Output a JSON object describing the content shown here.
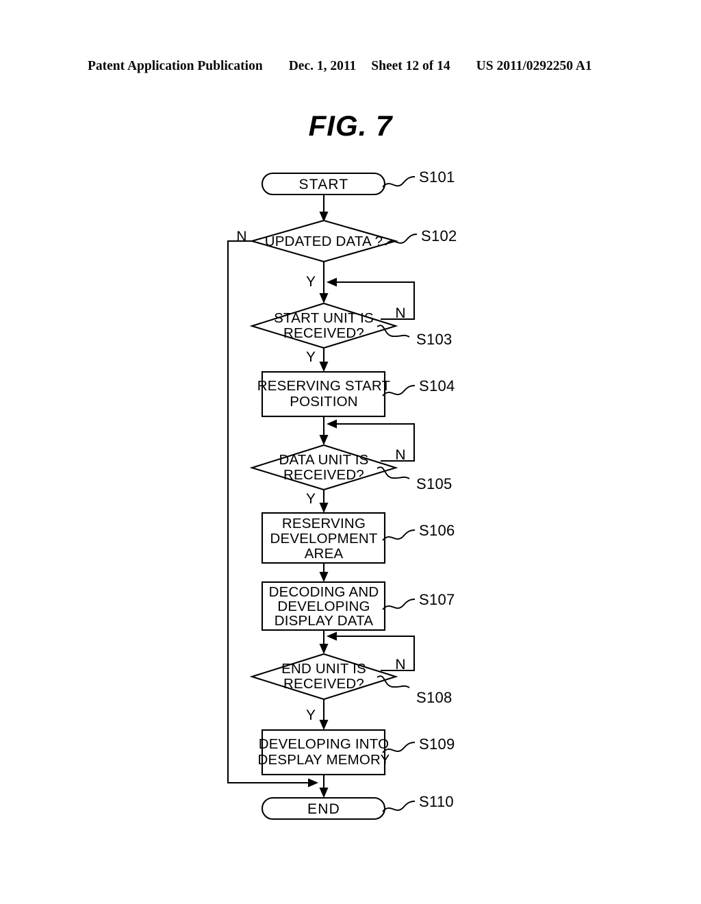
{
  "header": {
    "publication": "Patent Application Publication",
    "date": "Dec. 1, 2011",
    "sheet": "Sheet 12 of 14",
    "patent_number": "US 2011/0292250 A1"
  },
  "figure": {
    "title": "FIG. 7"
  },
  "chart_data": {
    "type": "diagram",
    "diagram_kind": "flowchart",
    "title": "FIG. 7",
    "orientation": "top-to-bottom",
    "nodes": [
      {
        "id": "S101",
        "shape": "terminator",
        "text": "START",
        "step": "S101"
      },
      {
        "id": "S102",
        "shape": "decision",
        "text": "UPDATED DATA ?",
        "step": "S102"
      },
      {
        "id": "S103",
        "shape": "decision",
        "text": "START UNIT IS RECEIVED?",
        "step": "S103"
      },
      {
        "id": "S104",
        "shape": "process",
        "text": "RESERVING START POSITION",
        "step": "S104"
      },
      {
        "id": "S105",
        "shape": "decision",
        "text": "DATA UNIT IS RECEIVED?",
        "step": "S105"
      },
      {
        "id": "S106",
        "shape": "process",
        "text": "RESERVING DEVELOPMENT AREA",
        "step": "S106"
      },
      {
        "id": "S107",
        "shape": "process",
        "text": "DECODING AND DEVELOPING DISPLAY DATA",
        "step": "S107"
      },
      {
        "id": "S108",
        "shape": "decision",
        "text": "END UNIT IS RECEIVED?",
        "step": "S108"
      },
      {
        "id": "S109",
        "shape": "process",
        "text": "DEVELOPING INTO DESPLAY MEMORY",
        "step": "S109"
      },
      {
        "id": "S110",
        "shape": "terminator",
        "text": "END",
        "step": "S110"
      }
    ],
    "node_text_lines": {
      "S101": [
        "START"
      ],
      "S102": [
        "UPDATED DATA ?"
      ],
      "S103": [
        "START UNIT IS",
        "RECEIVED?"
      ],
      "S104": [
        "RESERVING START",
        "POSITION"
      ],
      "S105": [
        "DATA UNIT IS",
        "RECEIVED?"
      ],
      "S106": [
        "RESERVING",
        "DEVELOPMENT",
        "AREA"
      ],
      "S107": [
        "DECODING AND",
        "DEVELOPING",
        "DISPLAY DATA"
      ],
      "S108": [
        "END UNIT IS",
        "RECEIVED?"
      ],
      "S109": [
        "DEVELOPING INTO",
        "DESPLAY MEMORY"
      ],
      "S110": [
        "END"
      ]
    },
    "edges": [
      {
        "from": "S101",
        "to": "S102",
        "label": ""
      },
      {
        "from": "S102",
        "to": "S110",
        "label": "N",
        "route": "left-bypass"
      },
      {
        "from": "S102",
        "to": "S103",
        "label": "Y"
      },
      {
        "from": "S103",
        "to": "S103",
        "label": "N",
        "route": "right-loopback"
      },
      {
        "from": "S103",
        "to": "S104",
        "label": "Y"
      },
      {
        "from": "S104",
        "to": "S105",
        "label": ""
      },
      {
        "from": "S105",
        "to": "S105",
        "label": "N",
        "route": "right-loopback"
      },
      {
        "from": "S105",
        "to": "S106",
        "label": "Y"
      },
      {
        "from": "S106",
        "to": "S107",
        "label": ""
      },
      {
        "from": "S107",
        "to": "S108",
        "label": ""
      },
      {
        "from": "S108",
        "to": "S108",
        "label": "N",
        "route": "right-loopback"
      },
      {
        "from": "S108",
        "to": "S109",
        "label": "Y"
      },
      {
        "from": "S109",
        "to": "S110",
        "label": ""
      }
    ],
    "branch_labels": {
      "yes": "Y",
      "no": "N"
    }
  },
  "steps": {
    "s101": "S101",
    "s102": "S102",
    "s103": "S103",
    "s104": "S104",
    "s105": "S105",
    "s106": "S106",
    "s107": "S107",
    "s108": "S108",
    "s109": "S109",
    "s110": "S110"
  },
  "nodes": {
    "start": {
      "l1": "START"
    },
    "updated": {
      "l1": "UPDATED DATA ?"
    },
    "startunit": {
      "l1": "START UNIT IS",
      "l2": "RECEIVED?"
    },
    "reserve": {
      "l1": "RESERVING START",
      "l2": "POSITION"
    },
    "dataunit": {
      "l1": "DATA UNIT IS",
      "l2": "RECEIVED?"
    },
    "devarea": {
      "l1": "RESERVING",
      "l2": "DEVELOPMENT",
      "l3": "AREA"
    },
    "decoding": {
      "l1": "DECODING AND",
      "l2": "DEVELOPING",
      "l3": "DISPLAY DATA"
    },
    "endunit": {
      "l1": "END UNIT IS",
      "l2": "RECEIVED?"
    },
    "devmemory": {
      "l1": "DEVELOPING INTO",
      "l2": "DESPLAY MEMORY"
    },
    "end": {
      "l1": "END"
    }
  },
  "branches": {
    "n102": "N",
    "y102": "Y",
    "n103": "N",
    "y103": "Y",
    "n105": "N",
    "y105": "Y",
    "n108": "N",
    "y108": "Y"
  },
  "colors": {
    "ink": "#000000",
    "paper": "#ffffff"
  }
}
